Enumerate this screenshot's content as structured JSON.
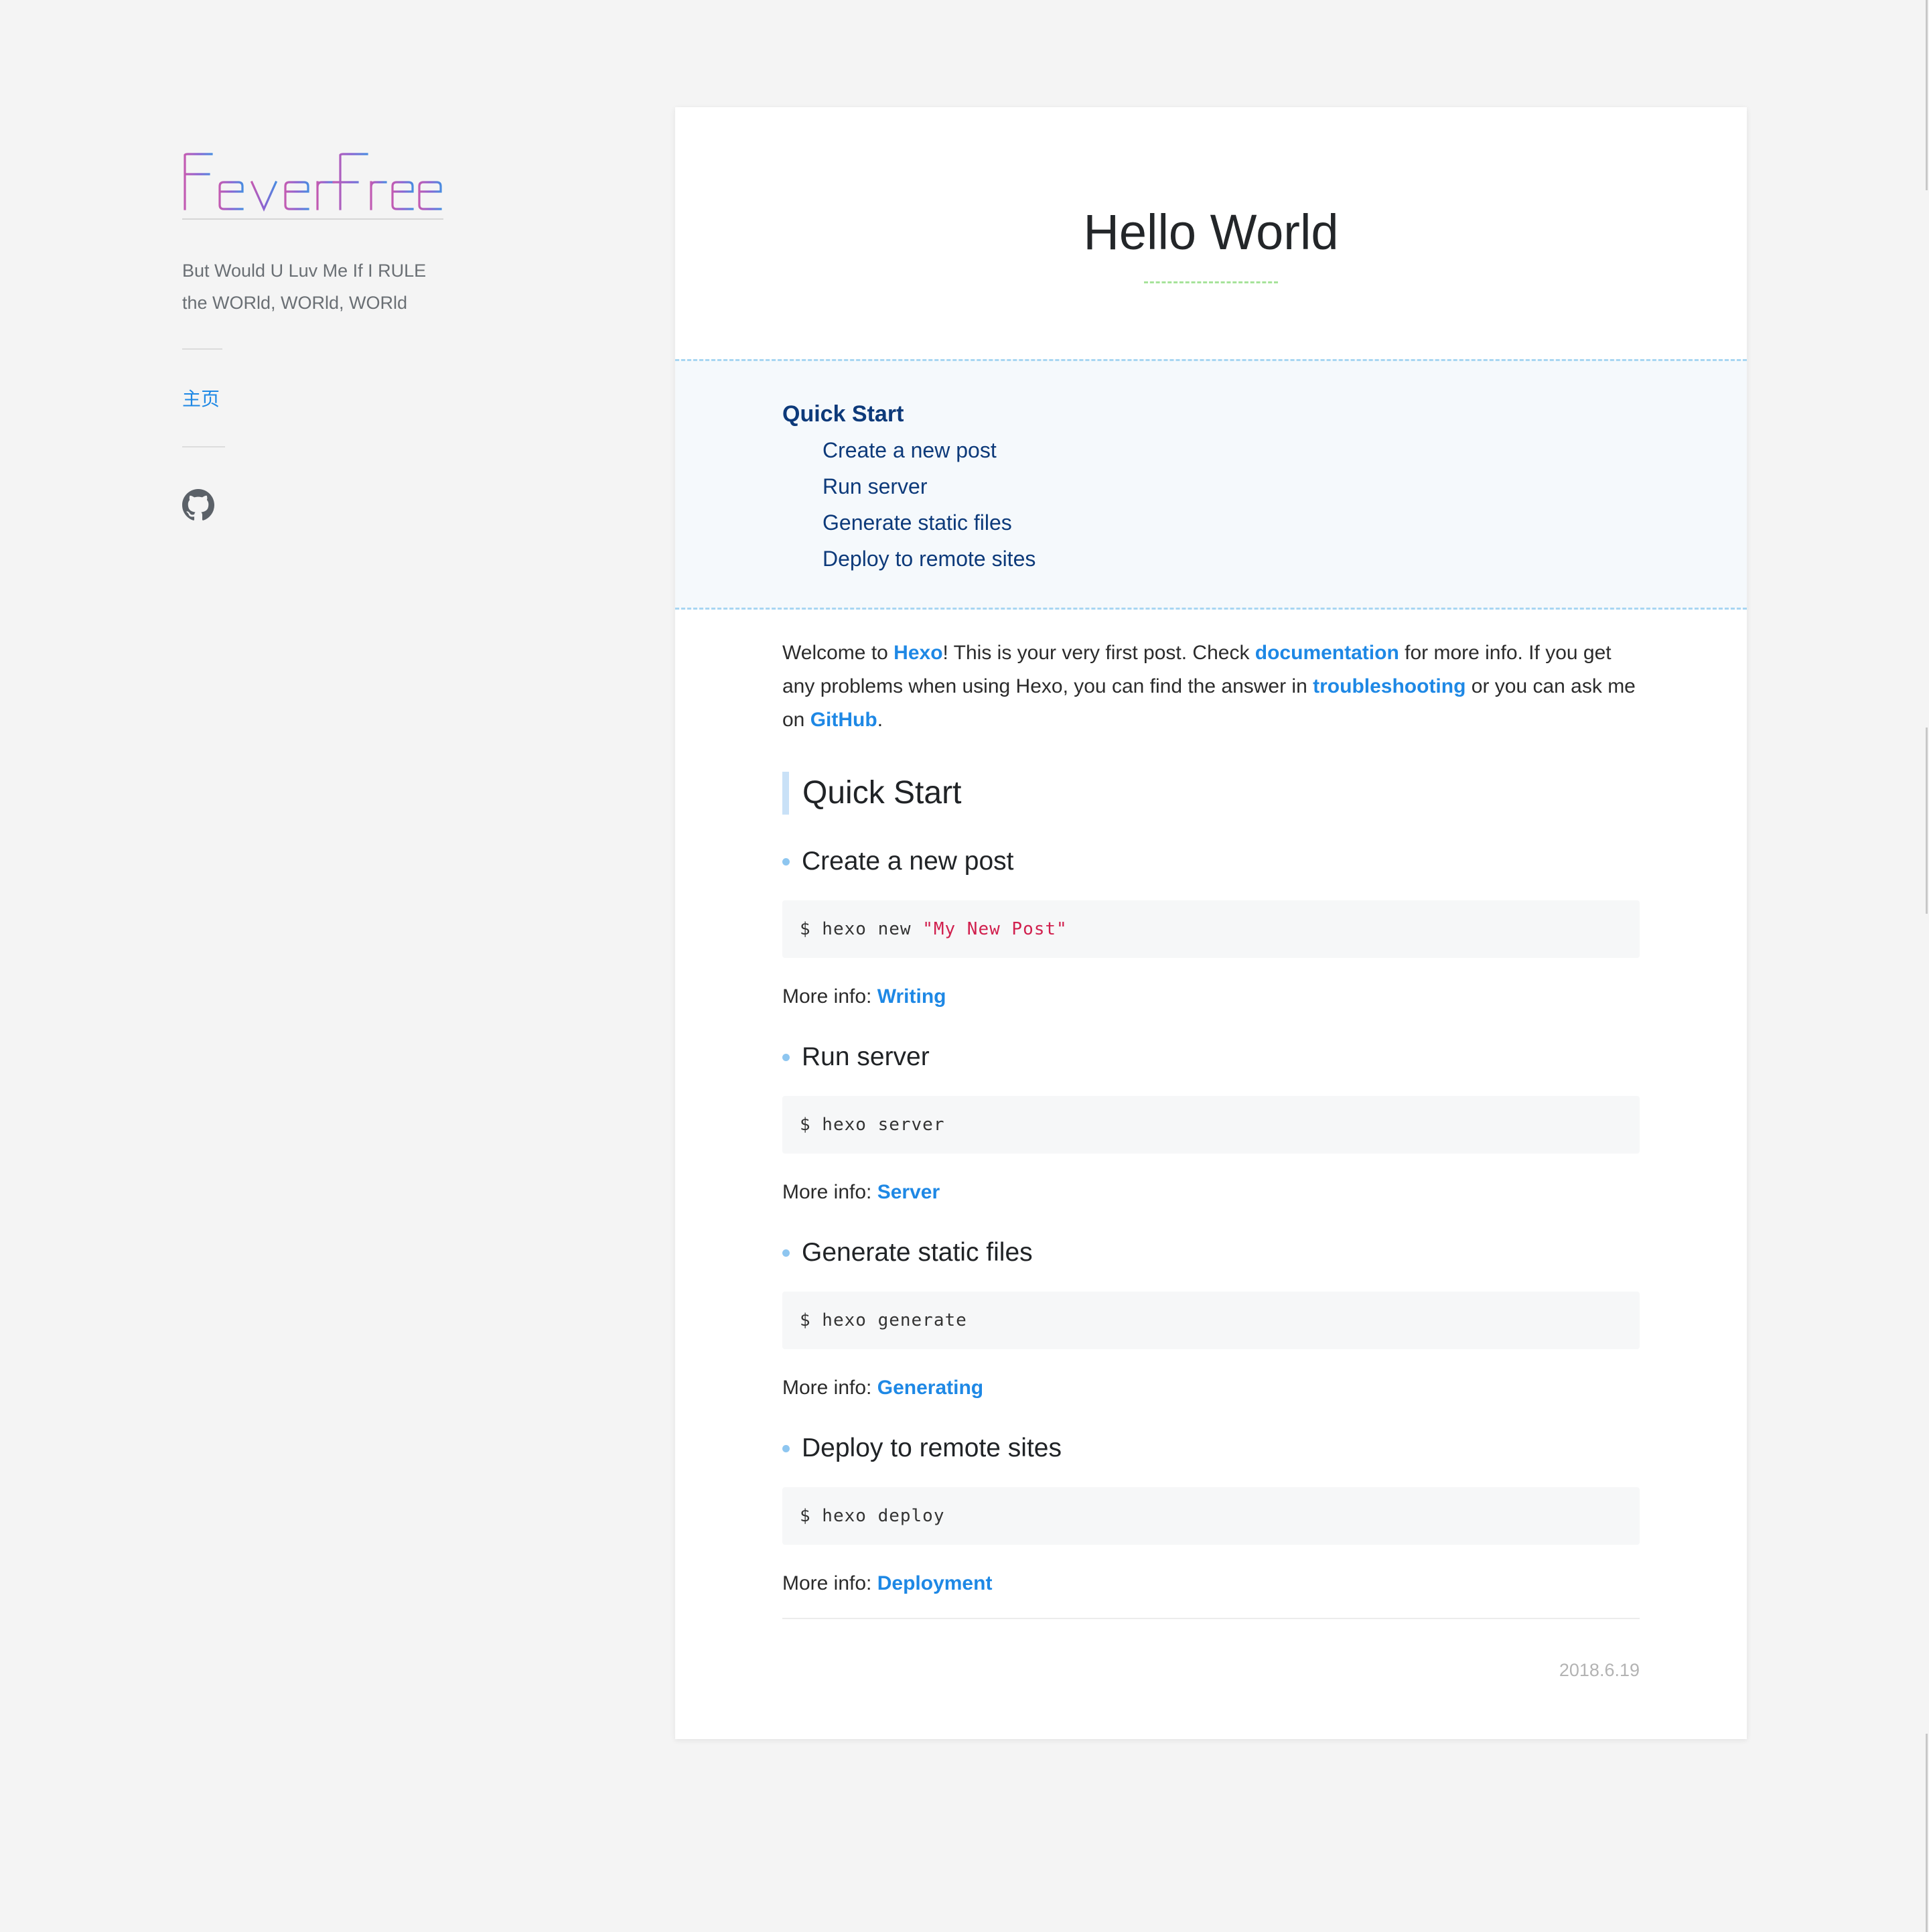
{
  "sidebar": {
    "logo_text": "FeverFree",
    "tagline_line1": "But Would U Luv Me If I RULE",
    "tagline_line2": "the WORld, WORld, WORld",
    "nav_home": "主页",
    "github_icon": "github-icon"
  },
  "post": {
    "title": "Hello World",
    "toc": {
      "main": "Quick Start",
      "items": [
        "Create a new post",
        "Run server",
        "Generate static files",
        "Deploy to remote sites"
      ]
    },
    "intro": {
      "t1": "Welcome to ",
      "link_hexo": "Hexo",
      "t2": "! This is your very first post. Check ",
      "link_docs": "documentation",
      "t3": " for more info. If you get any problems when using Hexo, you can find the answer in ",
      "link_trouble": "troubleshooting",
      "t4": " or you can ask me on ",
      "link_github": "GitHub",
      "t5": "."
    },
    "section_title": "Quick Start",
    "more_info_label": "More info: ",
    "steps": [
      {
        "title": "Create a new post",
        "code_cmd": "$ hexo new ",
        "code_str": "\"My New Post\"",
        "link": "Writing"
      },
      {
        "title": "Run server",
        "code_cmd": "$ hexo server",
        "code_str": "",
        "link": "Server"
      },
      {
        "title": "Generate static files",
        "code_cmd": "$ hexo generate",
        "code_str": "",
        "link": "Generating"
      },
      {
        "title": "Deploy to remote sites",
        "code_cmd": "$ hexo deploy",
        "code_str": "",
        "link": "Deployment"
      }
    ],
    "date": "2018.6.19"
  },
  "colors": {
    "link": "#1e88e5",
    "toc_text": "#0d3a7a",
    "toc_bg": "#f5f9fc",
    "code_string": "#d1204e",
    "title_underline": "#a6e39a"
  }
}
